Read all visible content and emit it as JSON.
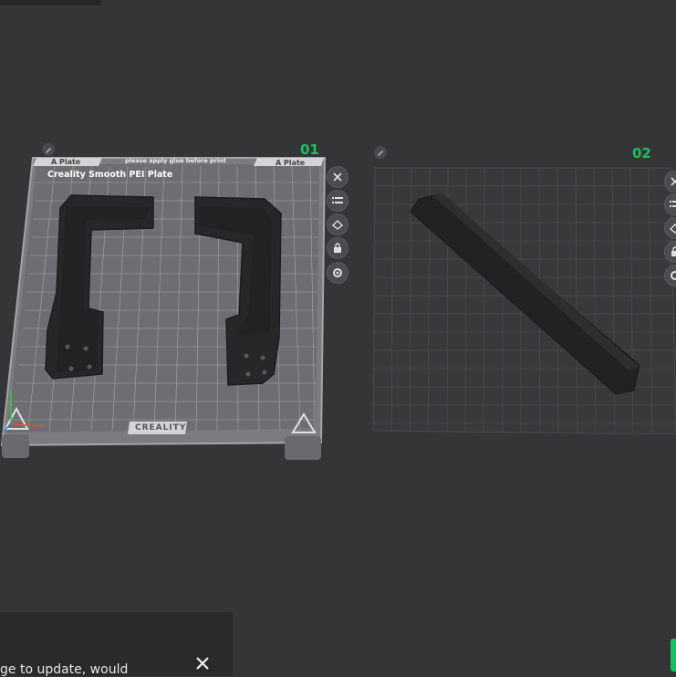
{
  "plates": [
    {
      "number": "01",
      "tab_left": "A Plate",
      "tab_right": "A Plate",
      "notice": "please apply glue before print",
      "surface_name": "Creality Smooth PEI Plate",
      "brand": "CREALITY"
    },
    {
      "number": "02"
    }
  ],
  "notification": {
    "text": "ge to update, would"
  },
  "colors": {
    "accent_green": "#17c15d",
    "background": "#353538"
  }
}
